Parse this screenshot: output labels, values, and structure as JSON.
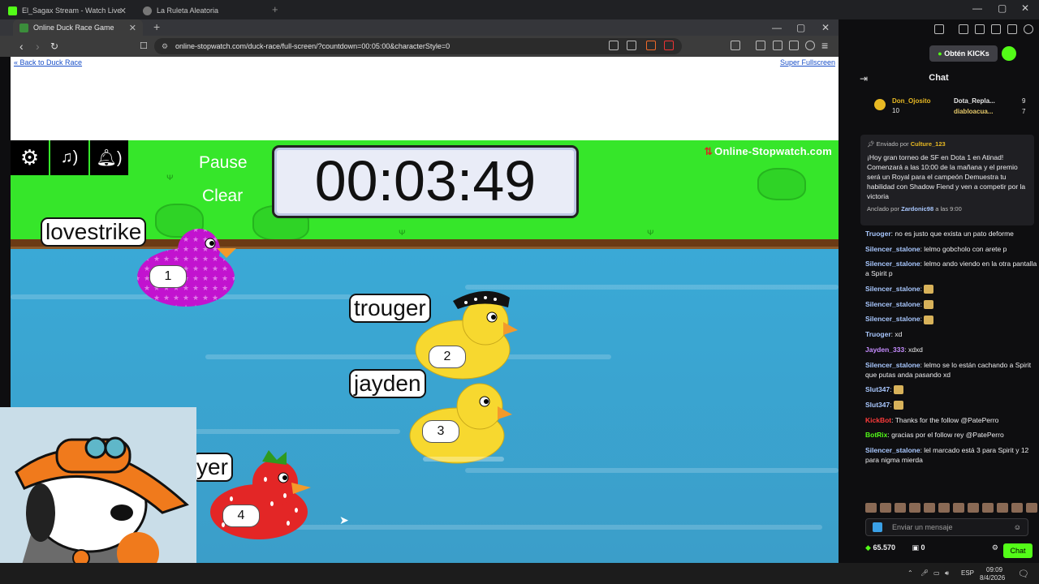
{
  "browser": {
    "tabs": [
      {
        "title": "El_Sagax Stream - Watch Live"
      },
      {
        "title": "La Ruleta Aleatoria"
      },
      {
        "title": "Online Duck Race Game"
      }
    ],
    "url": "online-stopwatch.com/duck-race/full-screen/?countdown=00:05:00&characterStyle=0"
  },
  "page": {
    "back_link": "« Back to Duck Race",
    "super_fullscreen": "Super Fullscreen",
    "brand": "Online-Stopwatch.com",
    "pause_label": "Pause",
    "clear_label": "Clear",
    "timer": "00:03:49",
    "ducks": [
      {
        "name": "lovestrike",
        "number": "1",
        "style": "purple-stars"
      },
      {
        "name": "trouger",
        "number": "2",
        "style": "yellow-cap"
      },
      {
        "name": "jayden",
        "number": "3",
        "style": "yellow"
      },
      {
        "name": "yer",
        "number": "4",
        "style": "strawberry"
      }
    ]
  },
  "chat": {
    "obtain_label": "Obtén KICKs",
    "title": "Chat",
    "top_users": [
      {
        "name": "Don_Ojosito",
        "count": "10"
      },
      {
        "name": "Dota_Repla...",
        "count": "9"
      },
      {
        "name": "diabloacua...",
        "count": "7"
      }
    ],
    "pinned": {
      "sent_by": "Enviado por",
      "author": "Culture_123",
      "text": "¡Hoy gran torneo de SF en Dota 1 en Atinad! Comenzará a las 10:00 de la mañana y el premio será un Royal para el campeón Demuestra tu habilidad con Shadow Fiend y ven a competir por la victoria",
      "pinned_by": "Anclado por",
      "pinned_user": "Zardonic98",
      "pinned_time": "a las 9:00"
    },
    "messages": [
      {
        "user": "Truoger",
        "text": "no es justo que exista un pato deforme",
        "color": "#a9c8ff"
      },
      {
        "user": "Silencer_stalone",
        "text": "lelmo gobcholo con arete p",
        "color": "#a9c8ff"
      },
      {
        "user": "Silencer_stalone",
        "text": "lelmo ando viendo en la otra pantalla a Spirit p",
        "color": "#a9c8ff"
      },
      {
        "user": "Silencer_stalone",
        "text": "",
        "color": "#a9c8ff",
        "emote": true
      },
      {
        "user": "Silencer_stalone",
        "text": "",
        "color": "#a9c8ff",
        "emote": true
      },
      {
        "user": "Silencer_stalone",
        "text": "",
        "color": "#a9c8ff",
        "emote": true
      },
      {
        "user": "Truoger",
        "text": "xd",
        "color": "#a9c8ff"
      },
      {
        "user": "Jayden_333",
        "text": "xdxd",
        "color": "#c58cff"
      },
      {
        "user": "Silencer_stalone",
        "text": "lelmo se lo están cachando a Spirit que putas anda pasando xd",
        "color": "#a9c8ff"
      },
      {
        "user": "Slut347",
        "text": "",
        "color": "#a9c8ff",
        "emote": true
      },
      {
        "user": "Slut347",
        "text": "",
        "color": "#a9c8ff",
        "emote": true
      },
      {
        "user": "KickBot",
        "text": "Thanks for the follow @PatePerro",
        "color": "#ff3b3b"
      },
      {
        "user": "BotRix",
        "text": "gracias por el follow rey @PatePerro",
        "color": "#53fc18"
      },
      {
        "user": "Silencer_stalone",
        "text": "lel marcado está 3 para Spirit y 12 para nigma mierda",
        "color": "#a9c8ff"
      }
    ],
    "input_placeholder": "Enviar un mensaje",
    "balance": "65.570",
    "zero": "0",
    "send_label": "Chat"
  },
  "taskbar": {
    "lang": "ESP",
    "time": "09:09",
    "date": "8/4/2026"
  }
}
